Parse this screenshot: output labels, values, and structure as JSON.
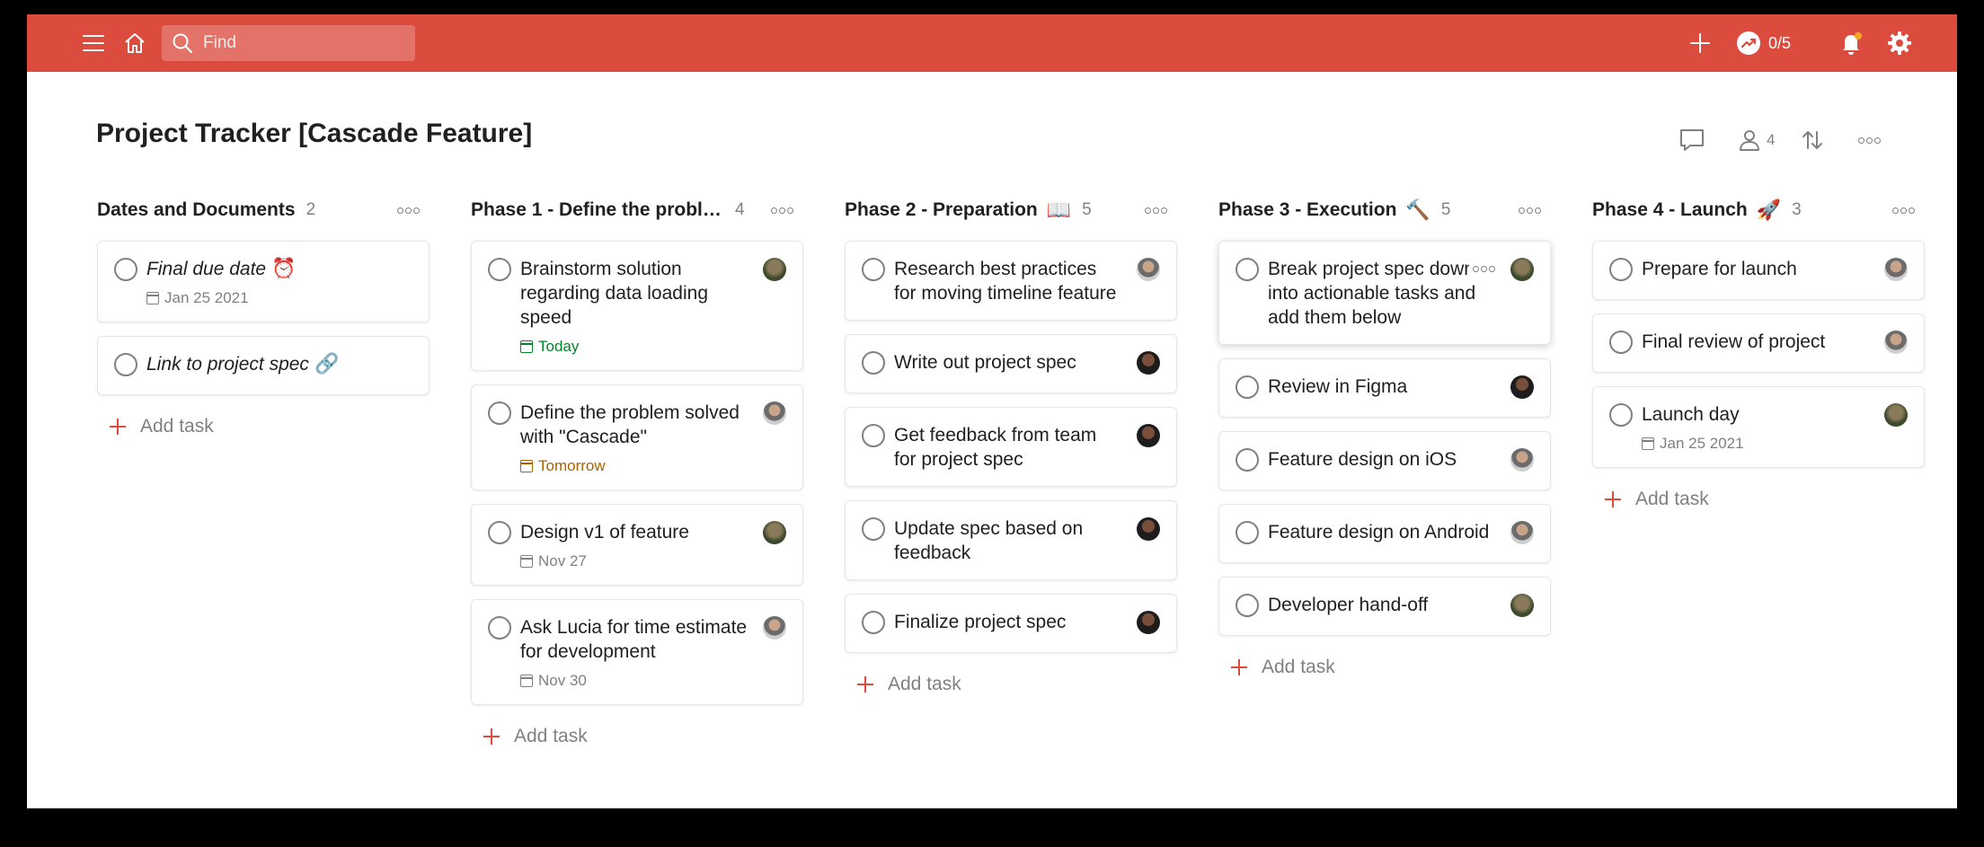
{
  "topbar": {
    "search_placeholder": "Find",
    "karma": "0/5",
    "icons": [
      "menu-icon",
      "home-icon",
      "search-icon",
      "plus-icon",
      "karma-icon",
      "bell-icon",
      "gear-icon"
    ],
    "colors": {
      "bar": "#db4c3f"
    }
  },
  "project": {
    "title": "Project Tracker [Cascade Feature]",
    "members_count": "4",
    "icons": [
      "comment-icon",
      "person-icon",
      "sort-icon",
      "more-icon"
    ]
  },
  "add_task_label": "Add task",
  "columns": [
    {
      "title": "Dates and Documents",
      "count": "2",
      "tasks": [
        {
          "title": "Final due date",
          "emoji": "⏰",
          "italic": true,
          "due": "Jan 25 2021",
          "due_color": "gray",
          "avatar": ""
        },
        {
          "title": "Link to project spec",
          "emoji": "🔗",
          "italic": true,
          "due": "",
          "due_color": "",
          "avatar": ""
        }
      ]
    },
    {
      "title": "Phase 1 - Define the proble…",
      "count": "4",
      "tasks": [
        {
          "title": "Brainstorm solution regarding data loading speed",
          "emoji": "",
          "italic": false,
          "due": "Today",
          "due_color": "green",
          "avatar": "a1"
        },
        {
          "title": "Define the problem solved with \"Cascade\"",
          "emoji": "",
          "italic": false,
          "due": "Tomorrow",
          "due_color": "orange",
          "avatar": "a2"
        },
        {
          "title": "Design v1 of feature",
          "emoji": "",
          "italic": false,
          "due": "Nov 27",
          "due_color": "gray",
          "avatar": "a1"
        },
        {
          "title": "Ask Lucia for time estimate for development",
          "emoji": "",
          "italic": false,
          "due": "Nov 30",
          "due_color": "gray",
          "avatar": "a2"
        }
      ]
    },
    {
      "title": "Phase 2 - Preparation",
      "emoji": "📖",
      "count": "5",
      "tasks": [
        {
          "title": "Research best practices for moving timeline feature",
          "emoji": "",
          "italic": false,
          "due": "",
          "due_color": "",
          "avatar": "a2"
        },
        {
          "title": "Write out project spec",
          "emoji": "",
          "italic": false,
          "due": "",
          "due_color": "",
          "avatar": "a3"
        },
        {
          "title": "Get feedback from team for project spec",
          "emoji": "",
          "italic": false,
          "due": "",
          "due_color": "",
          "avatar": "a3"
        },
        {
          "title": "Update spec based on feedback",
          "emoji": "",
          "italic": false,
          "due": "",
          "due_color": "",
          "avatar": "a3"
        },
        {
          "title": "Finalize project spec",
          "emoji": "",
          "italic": false,
          "due": "",
          "due_color": "",
          "avatar": "a3"
        }
      ]
    },
    {
      "title": "Phase 3 - Execution",
      "emoji": "🔨",
      "count": "5",
      "tasks": [
        {
          "title": "Break project spec down into actionable tasks and add them below",
          "emoji": "",
          "italic": false,
          "due": "",
          "due_color": "",
          "avatar": "a1",
          "hover": true
        },
        {
          "title": "Review in Figma",
          "emoji": "",
          "italic": false,
          "due": "",
          "due_color": "",
          "avatar": "a3"
        },
        {
          "title": "Feature design on iOS",
          "emoji": "",
          "italic": false,
          "due": "",
          "due_color": "",
          "avatar": "a2"
        },
        {
          "title": "Feature design on Android",
          "emoji": "",
          "italic": false,
          "due": "",
          "due_color": "",
          "avatar": "a2"
        },
        {
          "title": "Developer hand-off",
          "emoji": "",
          "italic": false,
          "due": "",
          "due_color": "",
          "avatar": "a1"
        }
      ]
    },
    {
      "title": "Phase 4 - Launch",
      "emoji": "🚀",
      "count": "3",
      "tasks": [
        {
          "title": "Prepare for launch",
          "emoji": "",
          "italic": false,
          "due": "",
          "due_color": "",
          "avatar": "a2"
        },
        {
          "title": "Final review of project",
          "emoji": "",
          "italic": false,
          "due": "",
          "due_color": "",
          "avatar": "a2"
        },
        {
          "title": "Launch day",
          "emoji": "",
          "italic": false,
          "due": "Jan 25 2021",
          "due_color": "gray",
          "avatar": "a1"
        }
      ]
    }
  ]
}
